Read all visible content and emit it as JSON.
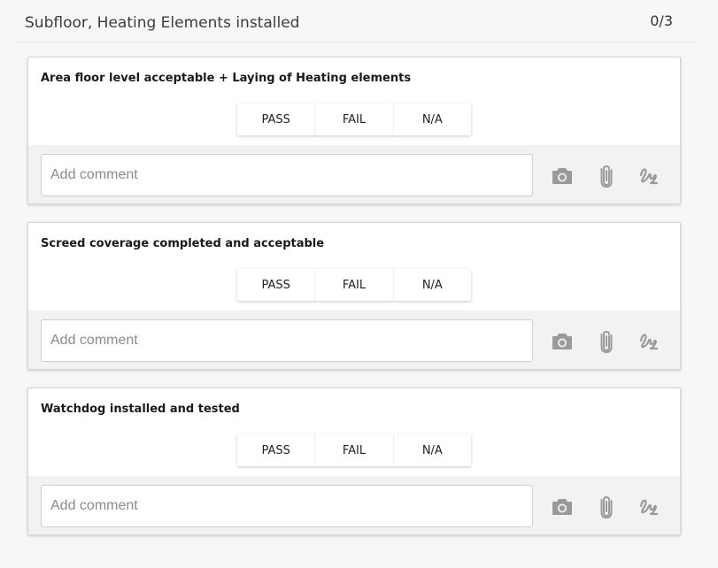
{
  "section": {
    "title": "Subfloor, Heating Elements installed",
    "count": "0/3"
  },
  "items": [
    {
      "title": "Area floor level acceptable + Laying of Heating elements",
      "options": [
        "PASS",
        "FAIL",
        "N/A"
      ],
      "comment_placeholder": "Add comment",
      "icons": [
        "camera-icon",
        "paperclip-icon",
        "signature-icon"
      ]
    },
    {
      "title": "Screed coverage completed and acceptable",
      "options": [
        "PASS",
        "FAIL",
        "N/A"
      ],
      "comment_placeholder": "Add comment",
      "icons": [
        "camera-icon",
        "paperclip-icon",
        "signature-icon"
      ]
    },
    {
      "title": "Watchdog installed and tested",
      "options": [
        "PASS",
        "FAIL",
        "N/A"
      ],
      "comment_placeholder": "Add comment",
      "icons": [
        "camera-icon",
        "paperclip-icon",
        "signature-icon"
      ]
    }
  ],
  "colors": {
    "background": "#f7f7f7",
    "card": "#ffffff",
    "comment_bar": "#f2f2f2",
    "icon": "#9a9a9a"
  }
}
